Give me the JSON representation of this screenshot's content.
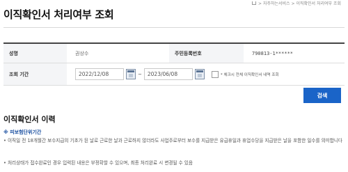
{
  "breadcrumb": {
    "text": "> 자주하는서비스 > 이직확인서 처리여부 조회"
  },
  "page": {
    "title": "이직확인서 처리여부 조회"
  },
  "search_form": {
    "name_label": "성명",
    "name_value": "권상수",
    "rrn_label": "주민등록번호",
    "rrn_value": "790813-1******",
    "period_label": "조회 기간",
    "date_from": "2022/12/08",
    "date_to": "2023/06/08",
    "range_separator": "~",
    "check_all_label": "* 체크시 전체 이직확인서 내역 조회",
    "check_all_checked": false
  },
  "search_button": {
    "label": "검색"
  },
  "history": {
    "title": "이직확인서 이력",
    "subhead": "※ 피보험단위기간",
    "bullet1": "• 이직일 전 18개월간 보수지급의 기초가 된 날로 근로한 날과 근로하지 않더라도 사업주로부터 보수를 지급받은 유급휴일과 휴업수당을 지급받은 날을 포함한 일수를 의미합니다",
    "bullet2": "• 처리상태가 접수완료인 경우 입력된 내용은 부정확할 수 있으며, 최종 처리완료 시 변경될 수 있음"
  },
  "colors": {
    "accent": "#1a64c8",
    "subhead": "#1a4fa0"
  }
}
